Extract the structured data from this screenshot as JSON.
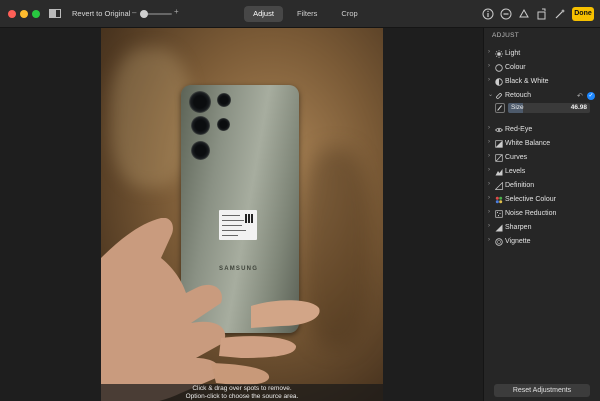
{
  "toolbar": {
    "revert_label": "Revert to Original",
    "zoom_minus": "–",
    "zoom_plus": "+",
    "zoom_level": 0.1,
    "tabs": [
      {
        "label": "Adjust",
        "active": true
      },
      {
        "label": "Filters",
        "active": false
      },
      {
        "label": "Crop",
        "active": false
      }
    ],
    "done_label": "Done",
    "colors": {
      "done_bg": "#f6c000",
      "active_tab": "#474747"
    },
    "icons": [
      "info-icon",
      "favorite-icon",
      "smart-retouch-icon",
      "rotate-icon",
      "auto-enhance-icon"
    ]
  },
  "canvas": {
    "hint_line1": "Click & drag over spots to remove.",
    "hint_line2": "Option-click to choose the source area.",
    "phone_brand": "SAMSUNG"
  },
  "sidebar": {
    "title": "ADJUST",
    "items": [
      {
        "label": "Light",
        "icon": "sun-icon",
        "expanded": false
      },
      {
        "label": "Colour",
        "icon": "circle-icon",
        "expanded": false
      },
      {
        "label": "Black & White",
        "icon": "half-circle-icon",
        "expanded": false
      },
      {
        "label": "Retouch",
        "icon": "bandage-icon",
        "expanded": true
      },
      {
        "label": "Red-Eye",
        "icon": "eye-icon",
        "expanded": false
      },
      {
        "label": "White Balance",
        "icon": "white-balance-icon",
        "expanded": false
      },
      {
        "label": "Curves",
        "icon": "curves-icon",
        "expanded": false
      },
      {
        "label": "Levels",
        "icon": "levels-icon",
        "expanded": false
      },
      {
        "label": "Definition",
        "icon": "definition-icon",
        "expanded": false
      },
      {
        "label": "Selective Colour",
        "icon": "selective-colour-icon",
        "expanded": false
      },
      {
        "label": "Noise Reduction",
        "icon": "noise-icon",
        "expanded": false
      },
      {
        "label": "Sharpen",
        "icon": "sharpen-icon",
        "expanded": false
      },
      {
        "label": "Vignette",
        "icon": "vignette-icon",
        "expanded": false
      }
    ],
    "retouch": {
      "size_label": "Size",
      "size_value": "46.98",
      "size_fraction": 0.18
    },
    "reset_label": "Reset Adjustments",
    "accent": "#1e88ff"
  }
}
